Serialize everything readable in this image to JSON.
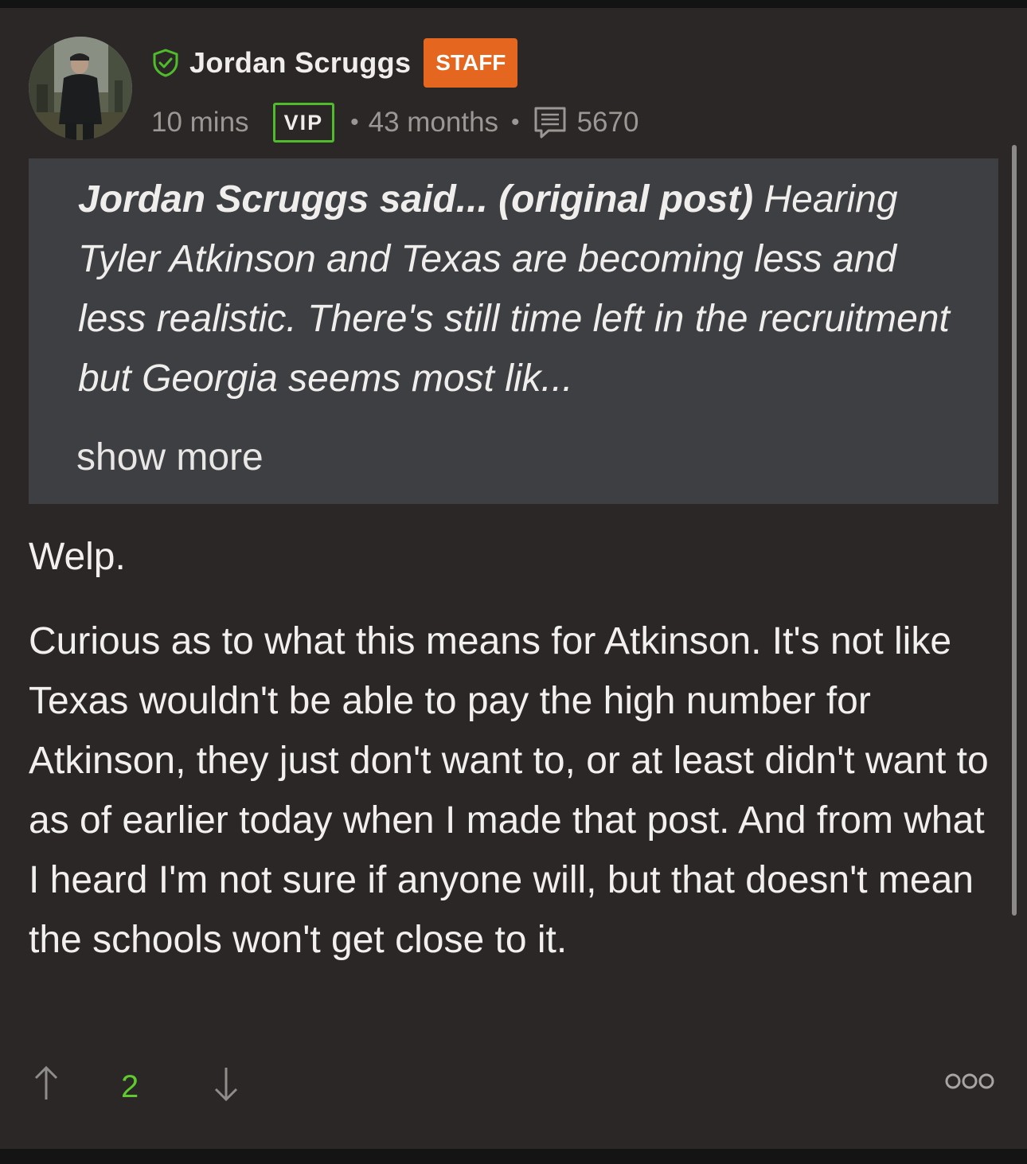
{
  "post": {
    "author": {
      "name": "Jordan Scruggs",
      "role_badge": "STAFF"
    },
    "meta": {
      "time_ago": "10 mins",
      "membership": "VIP",
      "tenure": "43 months",
      "separator": "•",
      "post_count": "5670"
    },
    "quote": {
      "attribution": "Jordan Scruggs said... (original post)",
      "excerpt": "Hearing Tyler Atkinson and Texas are becoming less and less realistic. There's still time left in the recruitment but Georgia seems most lik...",
      "show_more_label": "show more"
    },
    "body": {
      "paragraph_1": "Welp.",
      "paragraph_2": "Curious as to what this means for Atkinson. It's not like Texas wouldn't be able to pay the high number for Atkinson, they just don't want to, or at least didn't want to as of earlier today when I made that post. And from what I heard I'm not sure if anyone will, but that doesn't mean the schools won't get close to it."
    },
    "actions": {
      "vote_count": "2"
    }
  },
  "icons": {
    "verified": "shield-check-icon",
    "comments": "comment-icon",
    "upvote": "arrow-up-icon",
    "downvote": "arrow-down-icon",
    "more": "more-options-icon"
  },
  "colors": {
    "background": "#2b2726",
    "quote_background": "#3e3f42",
    "staff_badge": "#e4661f",
    "vip_border": "#4fbd2b",
    "vote_count": "#5fc92f",
    "muted_text": "#9a9794"
  }
}
